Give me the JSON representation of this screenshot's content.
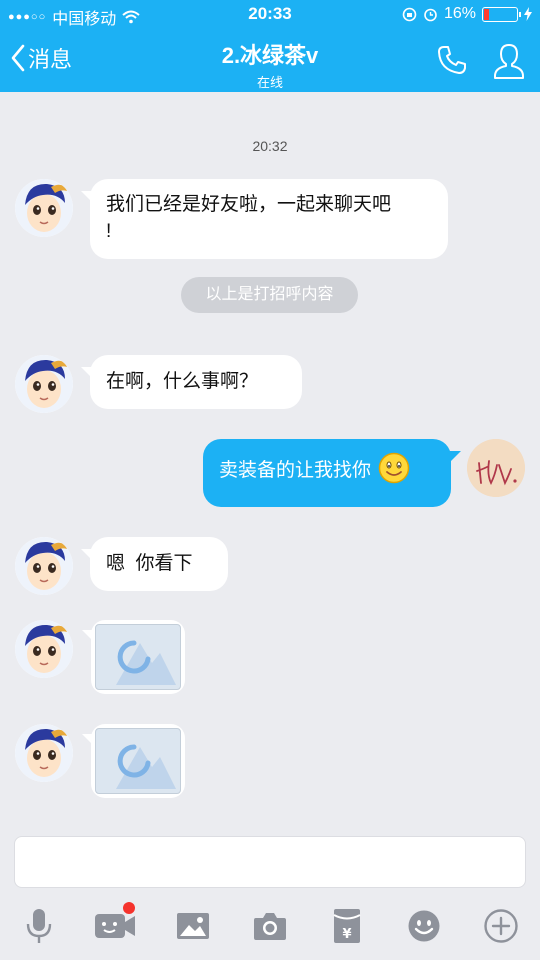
{
  "status_bar": {
    "carrier": "中国移动",
    "time": "20:33",
    "battery_text": "16%",
    "battery_level": 0.16
  },
  "nav": {
    "back_label": "消息",
    "title": "2.冰绿茶v",
    "subtitle": "在线"
  },
  "chat": {
    "timestamp": "20:32",
    "messages": [
      {
        "direction": "in",
        "text": "我们已经是好友啦，一起来聊天吧\n!"
      },
      {
        "direction": "in",
        "text": "在啊，什么事啊？"
      },
      {
        "direction": "out",
        "text": "卖装备的让我找你",
        "emoji": "smiley"
      },
      {
        "direction": "in",
        "text": "嗯  你看下"
      },
      {
        "direction": "in",
        "type": "image",
        "state": "loading"
      },
      {
        "direction": "in",
        "type": "image",
        "state": "loading"
      }
    ],
    "system_notice": "以上是打招呼内容",
    "my_avatar_text": "扯."
  },
  "input": {
    "placeholder": ""
  },
  "toolbar": {
    "items": [
      "microphone-icon",
      "video-icon",
      "image-icon",
      "camera-icon",
      "red-packet-icon",
      "emoji-icon",
      "plus-icon"
    ],
    "badge_on": "video-icon"
  },
  "colors": {
    "accent": "#1cb1f4",
    "background": "#ebecf0",
    "badge": "#f5332d"
  }
}
